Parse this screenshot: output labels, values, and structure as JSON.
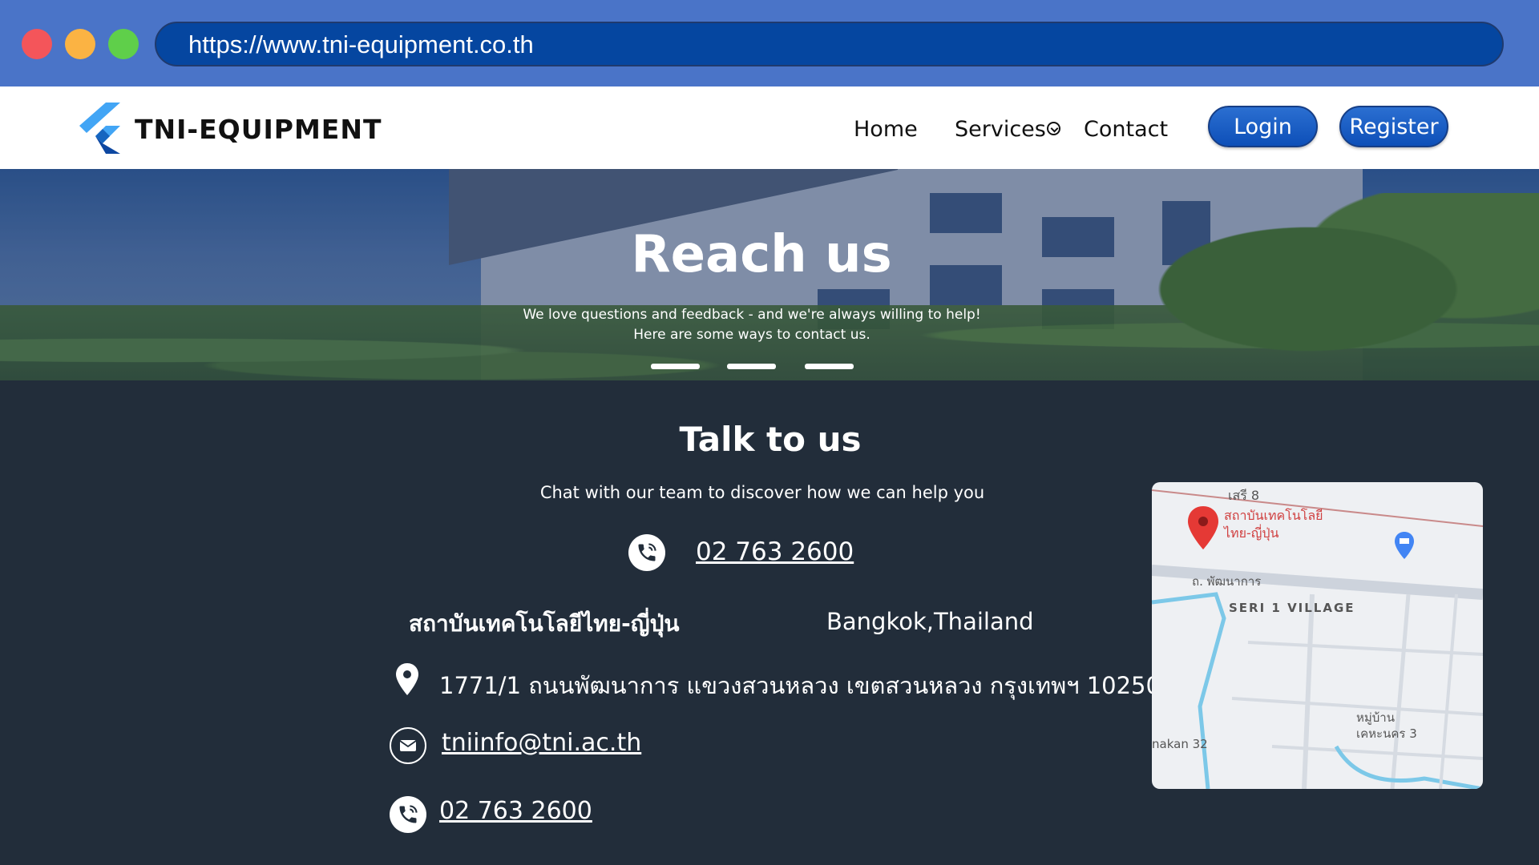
{
  "browser": {
    "url": "https://www.tni-equipment.co.th"
  },
  "navbar": {
    "brand": "TNI-EQUIPMENT",
    "links": [
      "Home",
      "Services",
      "Contact"
    ],
    "login_label": "Login",
    "register_label": "Register"
  },
  "hero": {
    "title": "Reach us",
    "subtitle_line1": "We love questions and feedback - and we're always willing to help!",
    "subtitle_line2": "Here are some ways to contact us.",
    "slide_count": 3
  },
  "contact": {
    "title": "Talk to us",
    "subtitle": "Chat with our team to discover how we can help you",
    "phone_main": "02 763 2600",
    "institute_name": "สถาบันเทคโนโลยีไทย-ญี่ปุ่น",
    "city": "Bangkok,Thailand",
    "address": "1771/1 ถนนพัฒนาการ แขวงสวนหลวง เขตสวนหลวง กรุงเทพฯ 10250",
    "email": "tniinfo@tni.ac.th",
    "phone_secondary": "02 763 2600"
  },
  "map": {
    "poi_line1": "สถาบันเทคโนโลยี",
    "poi_line2": "ไทย-ญี่ปุ่น",
    "road_label": "ถ. พัฒนาการ",
    "village_label": "SERI 1 VILLAGE",
    "top_label": "เสรี 8",
    "village2_line1": "หมู่บ้าน",
    "village2_line2": "เคหะนคร 3",
    "left_label": "nakan 32"
  },
  "colors": {
    "chrome": "#4a74c8",
    "urlbar": "#0546a0",
    "section_bg": "#222d3a",
    "button": "#0d4fb8"
  }
}
